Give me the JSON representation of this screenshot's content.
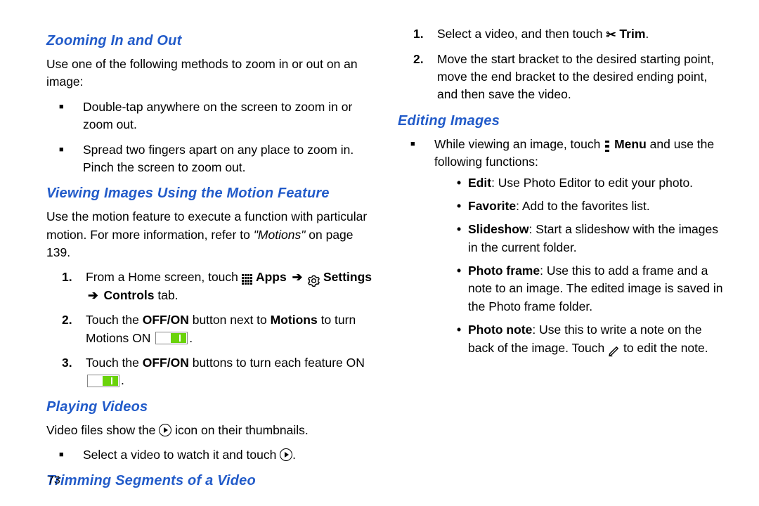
{
  "pageNumber": "73",
  "col1": {
    "h_zoom": "Zooming In and Out",
    "zoom_intro": "Use one of the following methods to zoom in or out on an image:",
    "zoom_b1": "Double-tap anywhere on the screen to zoom in or zoom out.",
    "zoom_b2": "Spread two fingers apart on any place to zoom in. Pinch the screen to zoom out.",
    "h_motion": "Viewing Images Using the Motion Feature",
    "motion_intro_a": "Use the motion feature to execute a function with particular motion. For more information, refer to ",
    "motion_intro_ref": "\"Motions\"",
    "motion_intro_b": " on page 139.",
    "step1_a": "From a Home screen, touch ",
    "step1_apps": " Apps ",
    "step1_settings": " Settings ",
    "step1_controls": " Controls",
    "step1_tab": " tab.",
    "step2_a": "Touch the ",
    "step2_offon": "OFF/ON",
    "step2_b": " button next to ",
    "step2_motions": "Motions",
    "step2_c": " to turn Motions ON ",
    "step2_d": ".",
    "step3_a": "Touch the ",
    "step3_offon": "OFF/ON",
    "step3_b": " buttons to turn each feature ON ",
    "step3_c": "."
  },
  "col2": {
    "h_play": "Playing Videos",
    "play_intro_a": "Video files show the ",
    "play_intro_b": " icon on their thumbnails.",
    "play_b1_a": "Select a video to watch it and touch ",
    "play_b1_b": ".",
    "h_trim": "Trimming Segments of a Video",
    "trim1_a": "Select a video, and then touch ",
    "trim1_label": " Trim",
    "trim1_b": ".",
    "trim2": "Move the start bracket to the desired starting point, move the end bracket to the desired ending point, and then save the video.",
    "h_edit": "Editing Images",
    "edit_b1_a": "While viewing an image, touch ",
    "edit_b1_menu": " Menu",
    "edit_b1_b": " and use the following functions:",
    "fn_edit_k": "Edit",
    "fn_edit_v": ": Use Photo Editor to edit your photo.",
    "fn_fav_k": "Favorite",
    "fn_fav_v": ": Add to the favorites list.",
    "fn_slide_k": "Slideshow",
    "fn_slide_v": ": Start a slideshow with the images in the current folder.",
    "fn_frame_k": "Photo frame",
    "fn_frame_v": ": Use this to add a frame and a note to an image. The edited image is saved in the Photo frame folder.",
    "fn_note_k": "Photo note",
    "fn_note_v1": ": Use this to write a note on the back of the image. Touch ",
    "fn_note_v2": " to edit the note."
  }
}
